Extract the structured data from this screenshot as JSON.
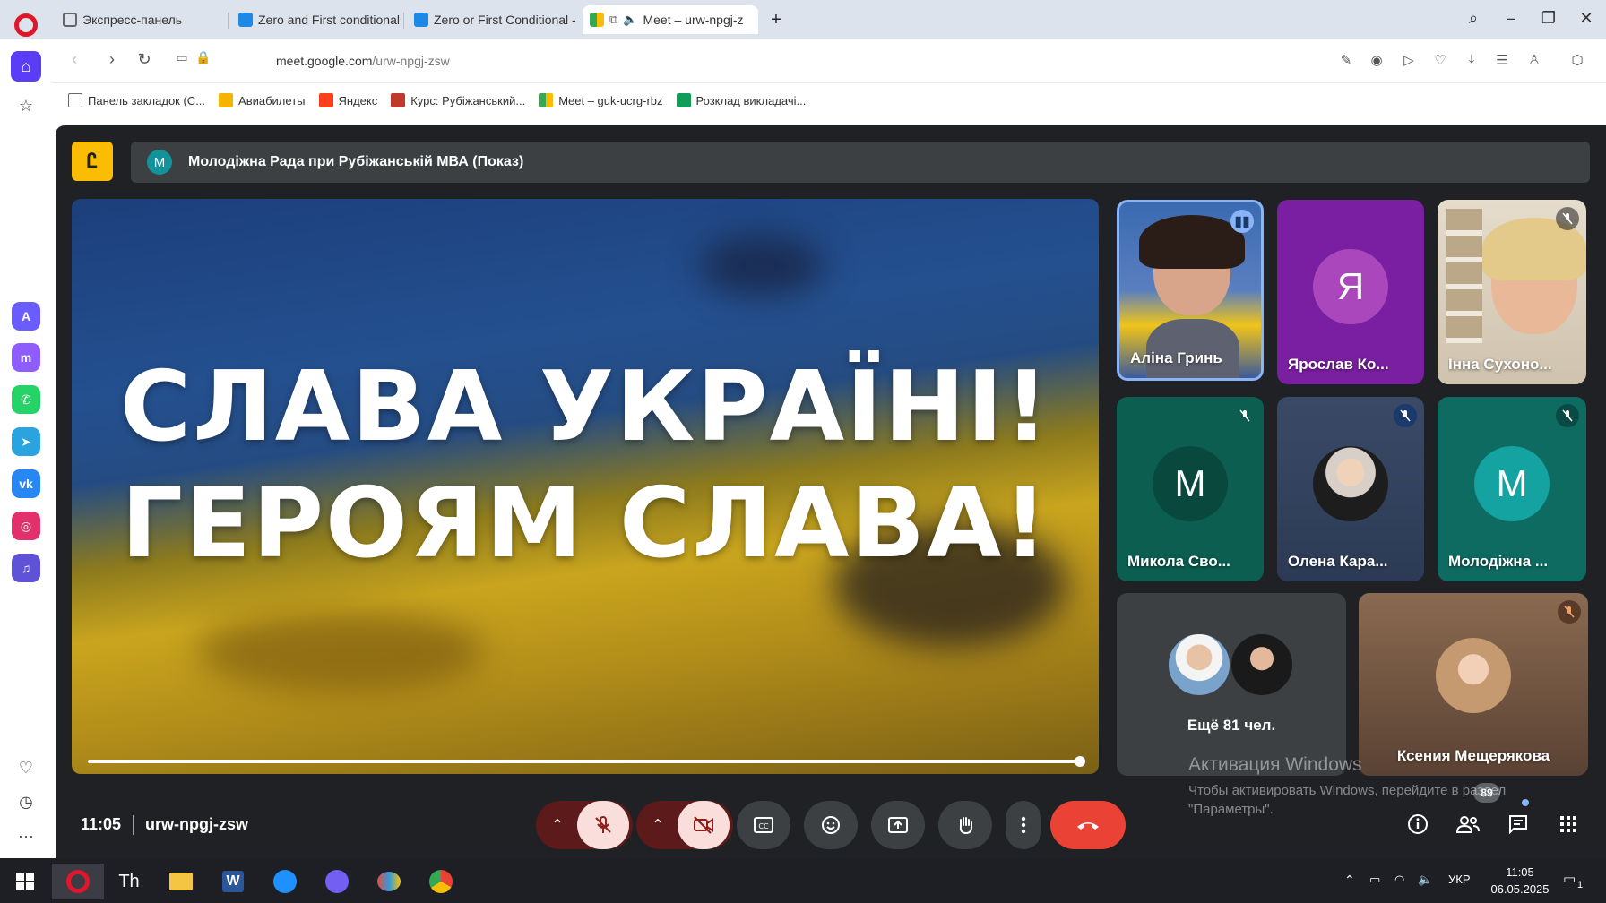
{
  "browser": {
    "tabs": [
      {
        "label": "Экспресс-панель"
      },
      {
        "label": "Zero and First conditional"
      },
      {
        "label": "Zero or First Conditional -"
      },
      {
        "label": "Meet – urw-npgj-z"
      }
    ],
    "url_host": "meet.google.com",
    "url_path": "/urw-npgj-zsw",
    "bookmarks": [
      {
        "label": "Панель закладок (С..."
      },
      {
        "label": "Авиабилеты"
      },
      {
        "label": "Яндекс"
      },
      {
        "label": "Курс: Рубіжанський..."
      },
      {
        "label": "Meet – guk-ucrg-rbz"
      },
      {
        "label": "Розклад викладачі..."
      }
    ]
  },
  "meet": {
    "logo_glyph": "Ꮭ",
    "meeting_title": "Молодіжна Рада при Рубіжанській МВА (Показ)",
    "title_avatar": "М",
    "presentation": {
      "line1": "СЛАВА УКРАЇНІ!",
      "line2": "ГЕРОЯМ СЛАВА!"
    },
    "participants": [
      {
        "name": "Аліна Гринь",
        "speaking": true
      },
      {
        "name": "Ярослав Ко...",
        "initial": "Я"
      },
      {
        "name": "Інна Сухоно..."
      },
      {
        "name": "Микола Сво...",
        "initial": "М"
      },
      {
        "name": "Олена Кара..."
      },
      {
        "name": "Молодіжна ...",
        "initial": "М"
      }
    ],
    "more_participants": "Ещё 81 чел.",
    "bottom_tile_name": "Ксения Мещерякова",
    "time": "11:05",
    "meeting_code": "urw-npgj-zsw",
    "people_count": "89"
  },
  "watermark": {
    "title": "Активация Windows",
    "line1": "Чтобы активировать Windows, перейдите в раздел",
    "line2": "\"Параметры\"."
  },
  "taskbar": {
    "lang": "УКР",
    "time": "11:05",
    "date": "06.05.2025",
    "notif_count": "1"
  },
  "colors": {
    "meet_bg": "#202124",
    "end_call": "#ea4335",
    "muted_btn": "#f9dedc",
    "speaking_border": "#8ab4f8"
  }
}
